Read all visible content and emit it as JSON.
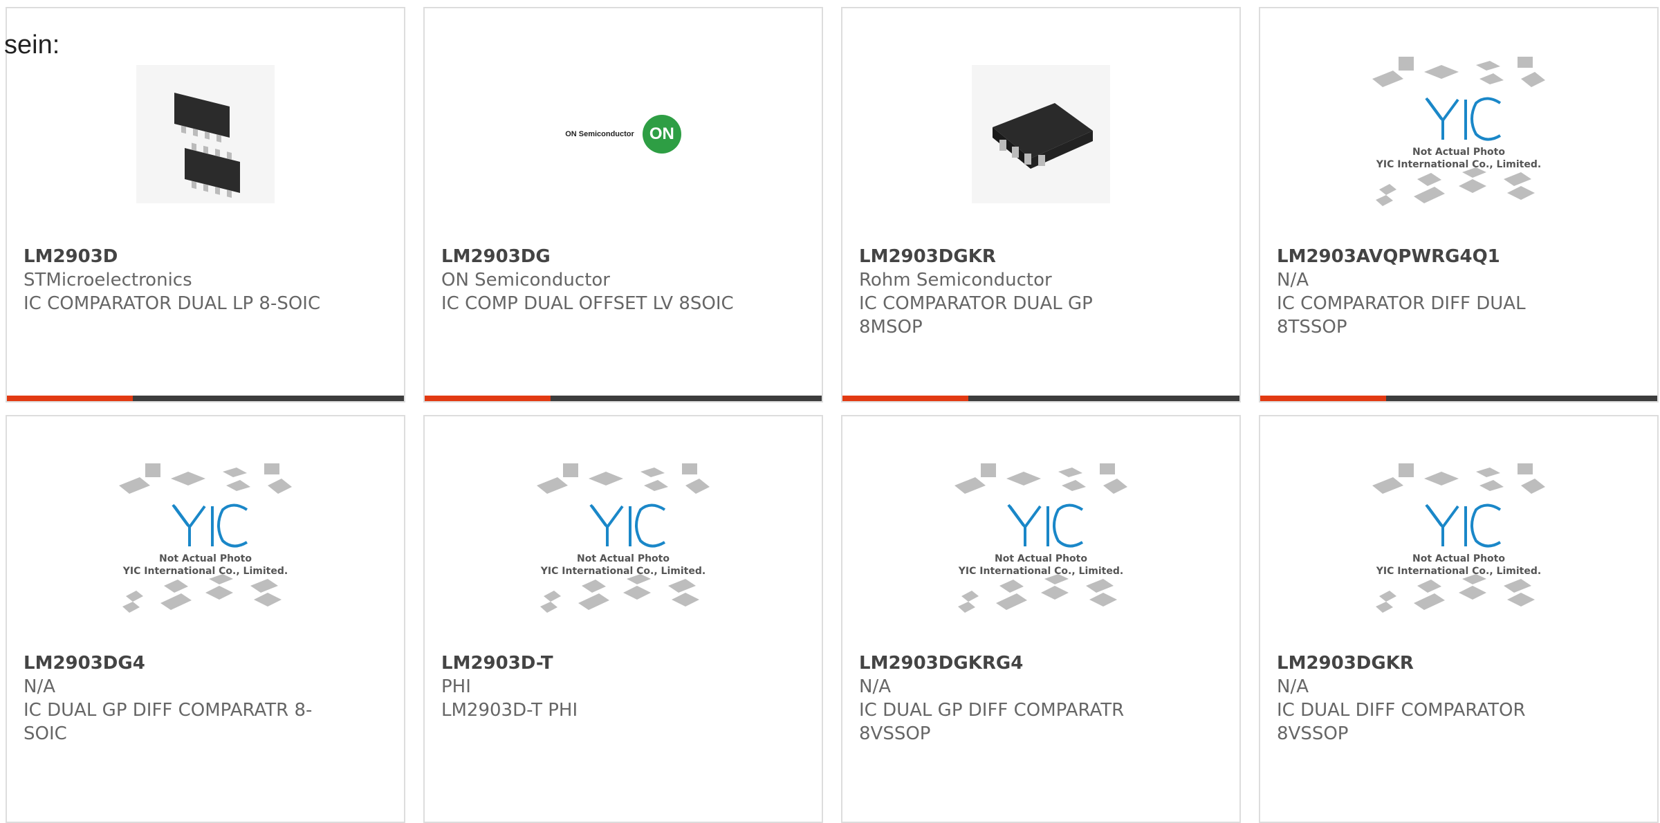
{
  "intro": "sein:",
  "products": [
    {
      "part": "LM2903D",
      "mfr": "STMicroelectronics",
      "desc": "IC COMPARATOR DUAL LP 8-SOIC",
      "image": "chip-pair-photo"
    },
    {
      "part": "LM2903DG",
      "mfr": "ON Semiconductor",
      "desc": "IC COMP DUAL OFFSET LV 8SOIC",
      "image": "on-semi-logo",
      "logo_text": "ON Semiconductor",
      "logo_badge": "ON"
    },
    {
      "part": "LM2903DGKR",
      "mfr": "Rohm Semiconductor",
      "desc": "IC COMPARATOR DUAL GP 8MSOP",
      "image": "chip-photo"
    },
    {
      "part": "LM2903AVQPWRG4Q1",
      "mfr": "N/A",
      "desc": "IC COMPARATOR DIFF DUAL 8TSSOP",
      "image": "placeholder"
    },
    {
      "part": "LM2903DG4",
      "mfr": "N/A",
      "desc": "IC DUAL GP DIFF COMPARATR 8-SOIC",
      "image": "placeholder"
    },
    {
      "part": "LM2903D-T",
      "mfr": "PHI",
      "desc": "LM2903D-T PHI",
      "image": "placeholder"
    },
    {
      "part": "LM2903DGKRG4",
      "mfr": "N/A",
      "desc": "IC DUAL GP DIFF COMPARATR 8VSSOP",
      "image": "placeholder"
    },
    {
      "part": "LM2903DGKR",
      "mfr": "N/A",
      "desc": "IC DUAL DIFF COMPARATOR 8VSSOP",
      "image": "placeholder"
    }
  ],
  "placeholder": {
    "line1": "Not Actual Photo",
    "line2": "YIC International Co., Limited."
  },
  "colors": {
    "accent": "#e23a12",
    "bar": "#3d3d3d",
    "border": "#dddddd",
    "yic_blue": "#1a87c8"
  }
}
